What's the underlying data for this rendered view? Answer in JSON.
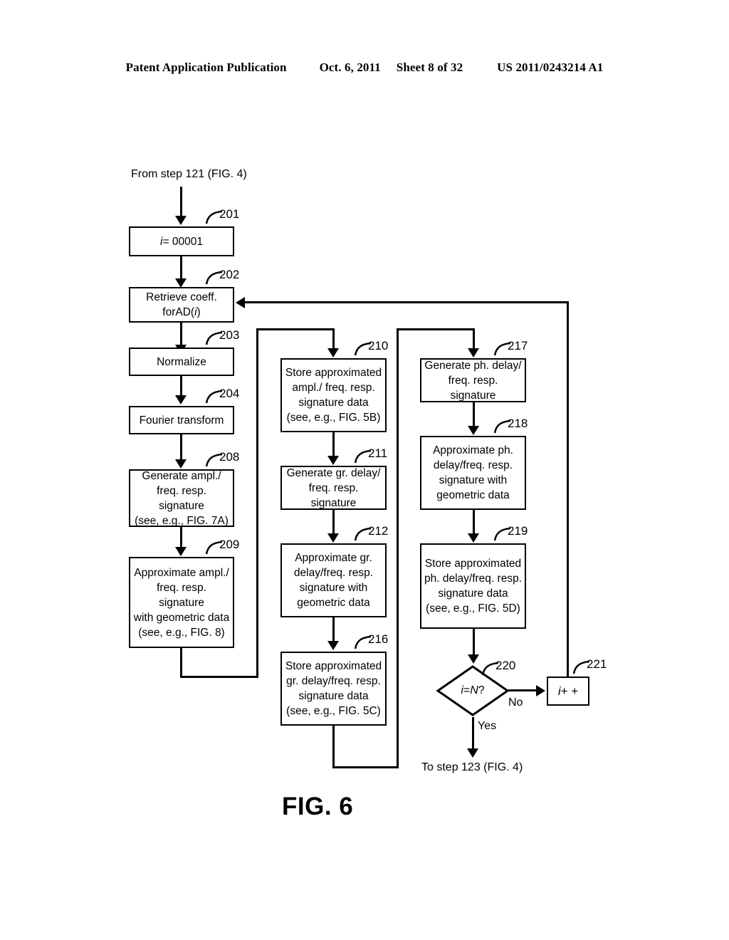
{
  "header": {
    "publication": "Patent Application Publication",
    "date": "Oct. 6, 2011",
    "sheet": "Sheet 8 of 32",
    "patent_number": "US 2011/0243214 A1"
  },
  "figure": {
    "caption": "FIG. 6",
    "entry_note": "From step 121 (FIG. 4)",
    "exit_note": "To step 123 (FIG. 4)",
    "branch_no": "No",
    "branch_yes": "Yes",
    "nodes": [
      {
        "ref": "201",
        "text": "i = 00001"
      },
      {
        "ref": "202",
        "text": "Retrieve coeff. for\nAD(i)"
      },
      {
        "ref": "203",
        "text": "Normalize"
      },
      {
        "ref": "204",
        "text": "Fourier transform"
      },
      {
        "ref": "208",
        "text": "Generate ampl./\nfreq. resp. signature\n(see, e.g., FIG. 7A)"
      },
      {
        "ref": "209",
        "text": "Approximate ampl./\nfreq. resp. signature\nwith geometric data\n(see, e.g., FIG. 8)"
      },
      {
        "ref": "210",
        "text": "Store approximated\nampl./ freq. resp.\nsignature data\n(see, e.g., FIG. 5B)"
      },
      {
        "ref": "211",
        "text": "Generate gr. delay/\nfreq. resp. signature"
      },
      {
        "ref": "212",
        "text": "Approximate gr.\ndelay/freq. resp.\nsignature with\ngeometric data"
      },
      {
        "ref": "216",
        "text": "Store approximated\ngr. delay/freq. resp.\nsignature data\n(see, e.g., FIG. 5C)"
      },
      {
        "ref": "217",
        "text": "Generate ph. delay/\nfreq. resp. signature"
      },
      {
        "ref": "218",
        "text": "Approximate ph.\ndelay/freq. resp.\nsignature with\ngeometric data"
      },
      {
        "ref": "219",
        "text": "Store approximated\nph. delay/freq. resp.\nsignature data\n(see, e.g., FIG. 5D)"
      },
      {
        "ref": "220",
        "text": "i = N?"
      },
      {
        "ref": "221",
        "text": "i + +"
      }
    ]
  },
  "colors": {
    "ink": "#000000",
    "paper": "#ffffff"
  }
}
